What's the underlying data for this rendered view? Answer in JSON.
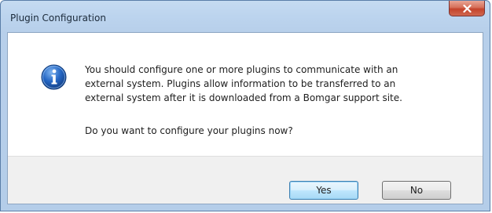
{
  "window": {
    "title": "Plugin Configuration",
    "close_icon": "close-icon"
  },
  "dialog": {
    "icon": "info-icon",
    "message_lines": [
      "You should configure one or more plugins to communicate with an",
      "external system.  Plugins allow information to be transferred to an",
      "external system after it is downloaded from a Bomgar support site."
    ],
    "question": "Do you want to configure your plugins now?"
  },
  "buttons": {
    "yes_label": "Yes",
    "no_label": "No"
  },
  "colors": {
    "titlebar": "#b9d1ea",
    "close_button": "#c75050",
    "info_icon": "#1f5fb8",
    "footer": "#f0f0f0"
  }
}
